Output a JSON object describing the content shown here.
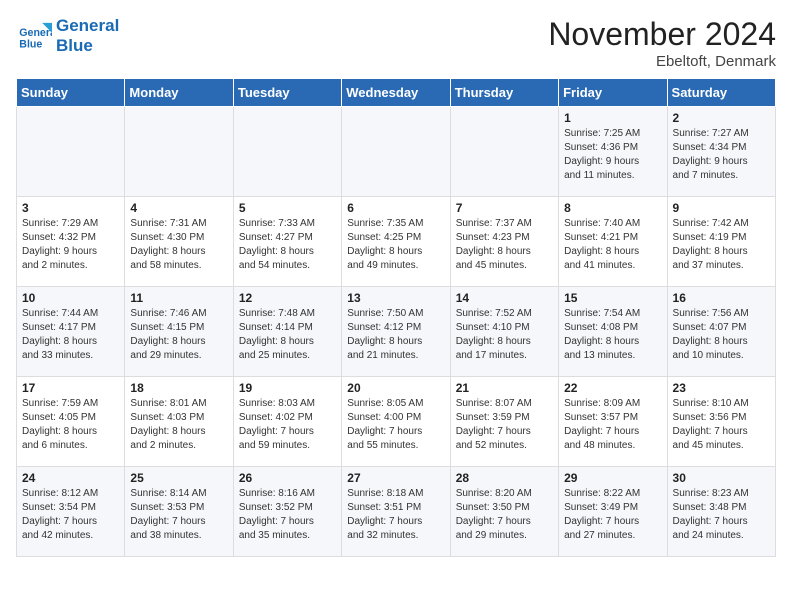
{
  "logo": {
    "line1": "General",
    "line2": "Blue"
  },
  "title": "November 2024",
  "location": "Ebeltoft, Denmark",
  "weekdays": [
    "Sunday",
    "Monday",
    "Tuesday",
    "Wednesday",
    "Thursday",
    "Friday",
    "Saturday"
  ],
  "weeks": [
    [
      {
        "day": "",
        "info": ""
      },
      {
        "day": "",
        "info": ""
      },
      {
        "day": "",
        "info": ""
      },
      {
        "day": "",
        "info": ""
      },
      {
        "day": "",
        "info": ""
      },
      {
        "day": "1",
        "info": "Sunrise: 7:25 AM\nSunset: 4:36 PM\nDaylight: 9 hours\nand 11 minutes."
      },
      {
        "day": "2",
        "info": "Sunrise: 7:27 AM\nSunset: 4:34 PM\nDaylight: 9 hours\nand 7 minutes."
      }
    ],
    [
      {
        "day": "3",
        "info": "Sunrise: 7:29 AM\nSunset: 4:32 PM\nDaylight: 9 hours\nand 2 minutes."
      },
      {
        "day": "4",
        "info": "Sunrise: 7:31 AM\nSunset: 4:30 PM\nDaylight: 8 hours\nand 58 minutes."
      },
      {
        "day": "5",
        "info": "Sunrise: 7:33 AM\nSunset: 4:27 PM\nDaylight: 8 hours\nand 54 minutes."
      },
      {
        "day": "6",
        "info": "Sunrise: 7:35 AM\nSunset: 4:25 PM\nDaylight: 8 hours\nand 49 minutes."
      },
      {
        "day": "7",
        "info": "Sunrise: 7:37 AM\nSunset: 4:23 PM\nDaylight: 8 hours\nand 45 minutes."
      },
      {
        "day": "8",
        "info": "Sunrise: 7:40 AM\nSunset: 4:21 PM\nDaylight: 8 hours\nand 41 minutes."
      },
      {
        "day": "9",
        "info": "Sunrise: 7:42 AM\nSunset: 4:19 PM\nDaylight: 8 hours\nand 37 minutes."
      }
    ],
    [
      {
        "day": "10",
        "info": "Sunrise: 7:44 AM\nSunset: 4:17 PM\nDaylight: 8 hours\nand 33 minutes."
      },
      {
        "day": "11",
        "info": "Sunrise: 7:46 AM\nSunset: 4:15 PM\nDaylight: 8 hours\nand 29 minutes."
      },
      {
        "day": "12",
        "info": "Sunrise: 7:48 AM\nSunset: 4:14 PM\nDaylight: 8 hours\nand 25 minutes."
      },
      {
        "day": "13",
        "info": "Sunrise: 7:50 AM\nSunset: 4:12 PM\nDaylight: 8 hours\nand 21 minutes."
      },
      {
        "day": "14",
        "info": "Sunrise: 7:52 AM\nSunset: 4:10 PM\nDaylight: 8 hours\nand 17 minutes."
      },
      {
        "day": "15",
        "info": "Sunrise: 7:54 AM\nSunset: 4:08 PM\nDaylight: 8 hours\nand 13 minutes."
      },
      {
        "day": "16",
        "info": "Sunrise: 7:56 AM\nSunset: 4:07 PM\nDaylight: 8 hours\nand 10 minutes."
      }
    ],
    [
      {
        "day": "17",
        "info": "Sunrise: 7:59 AM\nSunset: 4:05 PM\nDaylight: 8 hours\nand 6 minutes."
      },
      {
        "day": "18",
        "info": "Sunrise: 8:01 AM\nSunset: 4:03 PM\nDaylight: 8 hours\nand 2 minutes."
      },
      {
        "day": "19",
        "info": "Sunrise: 8:03 AM\nSunset: 4:02 PM\nDaylight: 7 hours\nand 59 minutes."
      },
      {
        "day": "20",
        "info": "Sunrise: 8:05 AM\nSunset: 4:00 PM\nDaylight: 7 hours\nand 55 minutes."
      },
      {
        "day": "21",
        "info": "Sunrise: 8:07 AM\nSunset: 3:59 PM\nDaylight: 7 hours\nand 52 minutes."
      },
      {
        "day": "22",
        "info": "Sunrise: 8:09 AM\nSunset: 3:57 PM\nDaylight: 7 hours\nand 48 minutes."
      },
      {
        "day": "23",
        "info": "Sunrise: 8:10 AM\nSunset: 3:56 PM\nDaylight: 7 hours\nand 45 minutes."
      }
    ],
    [
      {
        "day": "24",
        "info": "Sunrise: 8:12 AM\nSunset: 3:54 PM\nDaylight: 7 hours\nand 42 minutes."
      },
      {
        "day": "25",
        "info": "Sunrise: 8:14 AM\nSunset: 3:53 PM\nDaylight: 7 hours\nand 38 minutes."
      },
      {
        "day": "26",
        "info": "Sunrise: 8:16 AM\nSunset: 3:52 PM\nDaylight: 7 hours\nand 35 minutes."
      },
      {
        "day": "27",
        "info": "Sunrise: 8:18 AM\nSunset: 3:51 PM\nDaylight: 7 hours\nand 32 minutes."
      },
      {
        "day": "28",
        "info": "Sunrise: 8:20 AM\nSunset: 3:50 PM\nDaylight: 7 hours\nand 29 minutes."
      },
      {
        "day": "29",
        "info": "Sunrise: 8:22 AM\nSunset: 3:49 PM\nDaylight: 7 hours\nand 27 minutes."
      },
      {
        "day": "30",
        "info": "Sunrise: 8:23 AM\nSunset: 3:48 PM\nDaylight: 7 hours\nand 24 minutes."
      }
    ]
  ]
}
